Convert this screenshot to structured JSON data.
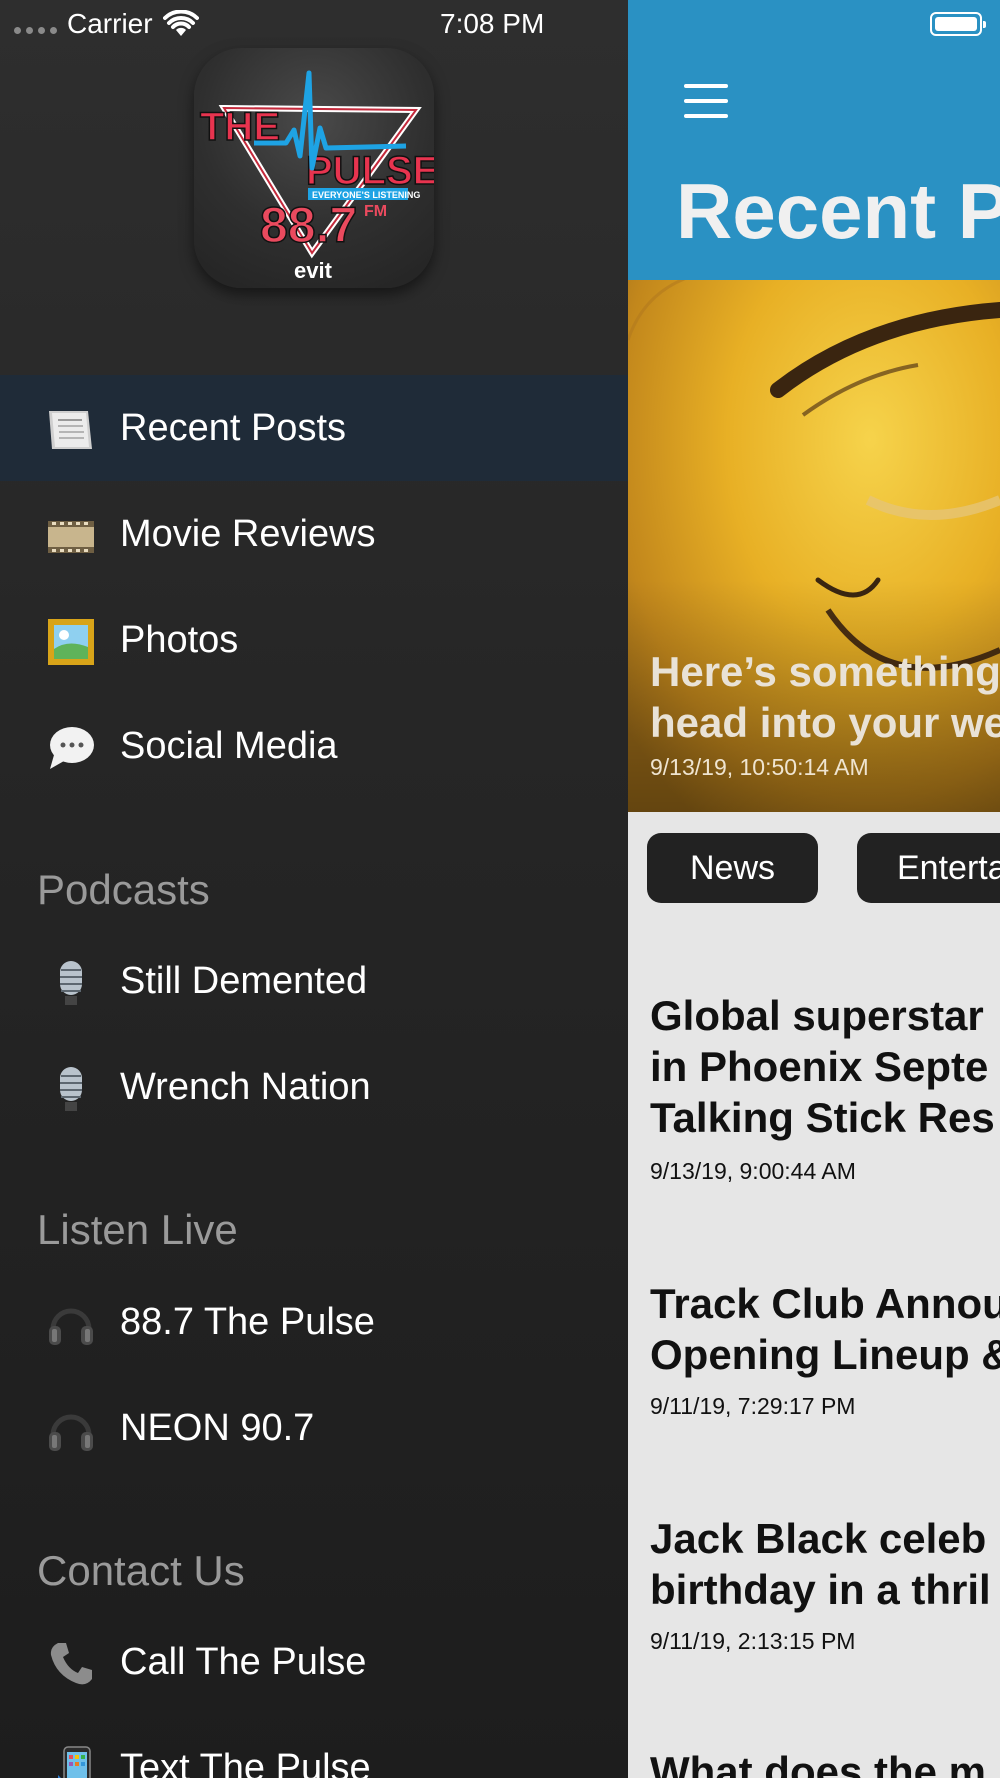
{
  "status_bar": {
    "carrier": "Carrier",
    "time": "7:08 PM",
    "wifi_icon": "wifi-icon",
    "battery_icon": "battery-icon"
  },
  "logo": {
    "text_the": "THE",
    "text_pulse": "PULSE",
    "text_tagline": "EVERYONE'S LISTENING",
    "text_freq": "88.7",
    "text_fm": "FM",
    "text_brand": "evit"
  },
  "drawer": {
    "items": [
      {
        "label": "Recent Posts",
        "icon": "newspaper-icon",
        "selected": true
      },
      {
        "label": "Movie Reviews",
        "icon": "film-reel-icon",
        "selected": false
      },
      {
        "label": "Photos",
        "icon": "picture-frame-icon",
        "selected": false
      },
      {
        "label": "Social Media",
        "icon": "speech-bubble-icon",
        "selected": false
      }
    ],
    "sections": [
      {
        "header": "Podcasts",
        "items": [
          {
            "label": "Still Demented",
            "icon": "microphone-icon"
          },
          {
            "label": "Wrench Nation",
            "icon": "microphone-icon"
          }
        ]
      },
      {
        "header": "Listen Live",
        "items": [
          {
            "label": "88.7 The Pulse",
            "icon": "headphones-icon"
          },
          {
            "label": "NEON 90.7",
            "icon": "headphones-icon"
          }
        ]
      },
      {
        "header": "Contact Us",
        "items": [
          {
            "label": "Call The Pulse",
            "icon": "phone-icon"
          },
          {
            "label": "Text The Pulse",
            "icon": "mobile-phone-icon"
          }
        ]
      }
    ]
  },
  "main": {
    "accent_color": "#2a91c3",
    "title": "Recent P",
    "menu_icon": "hamburger-icon",
    "hero": {
      "title_line1": "Here’s something",
      "title_line2": "head into your we",
      "date": "9/13/19, 10:50:14 AM"
    },
    "categories": [
      "News",
      "Enterta"
    ],
    "articles": [
      {
        "title_lines": [
          "Global superstar",
          "in Phoenix Septe",
          "Talking Stick Res"
        ],
        "date": "9/13/19, 9:00:44 AM"
      },
      {
        "title_lines": [
          "Track Club Annou",
          "Opening Lineup &"
        ],
        "date": "9/11/19, 7:29:17 PM"
      },
      {
        "title_lines": [
          "Jack Black celeb",
          "birthday in a thril"
        ],
        "date": "9/11/19, 2:13:15 PM"
      },
      {
        "title_lines": [
          "What does the m"
        ],
        "date": ""
      }
    ]
  }
}
